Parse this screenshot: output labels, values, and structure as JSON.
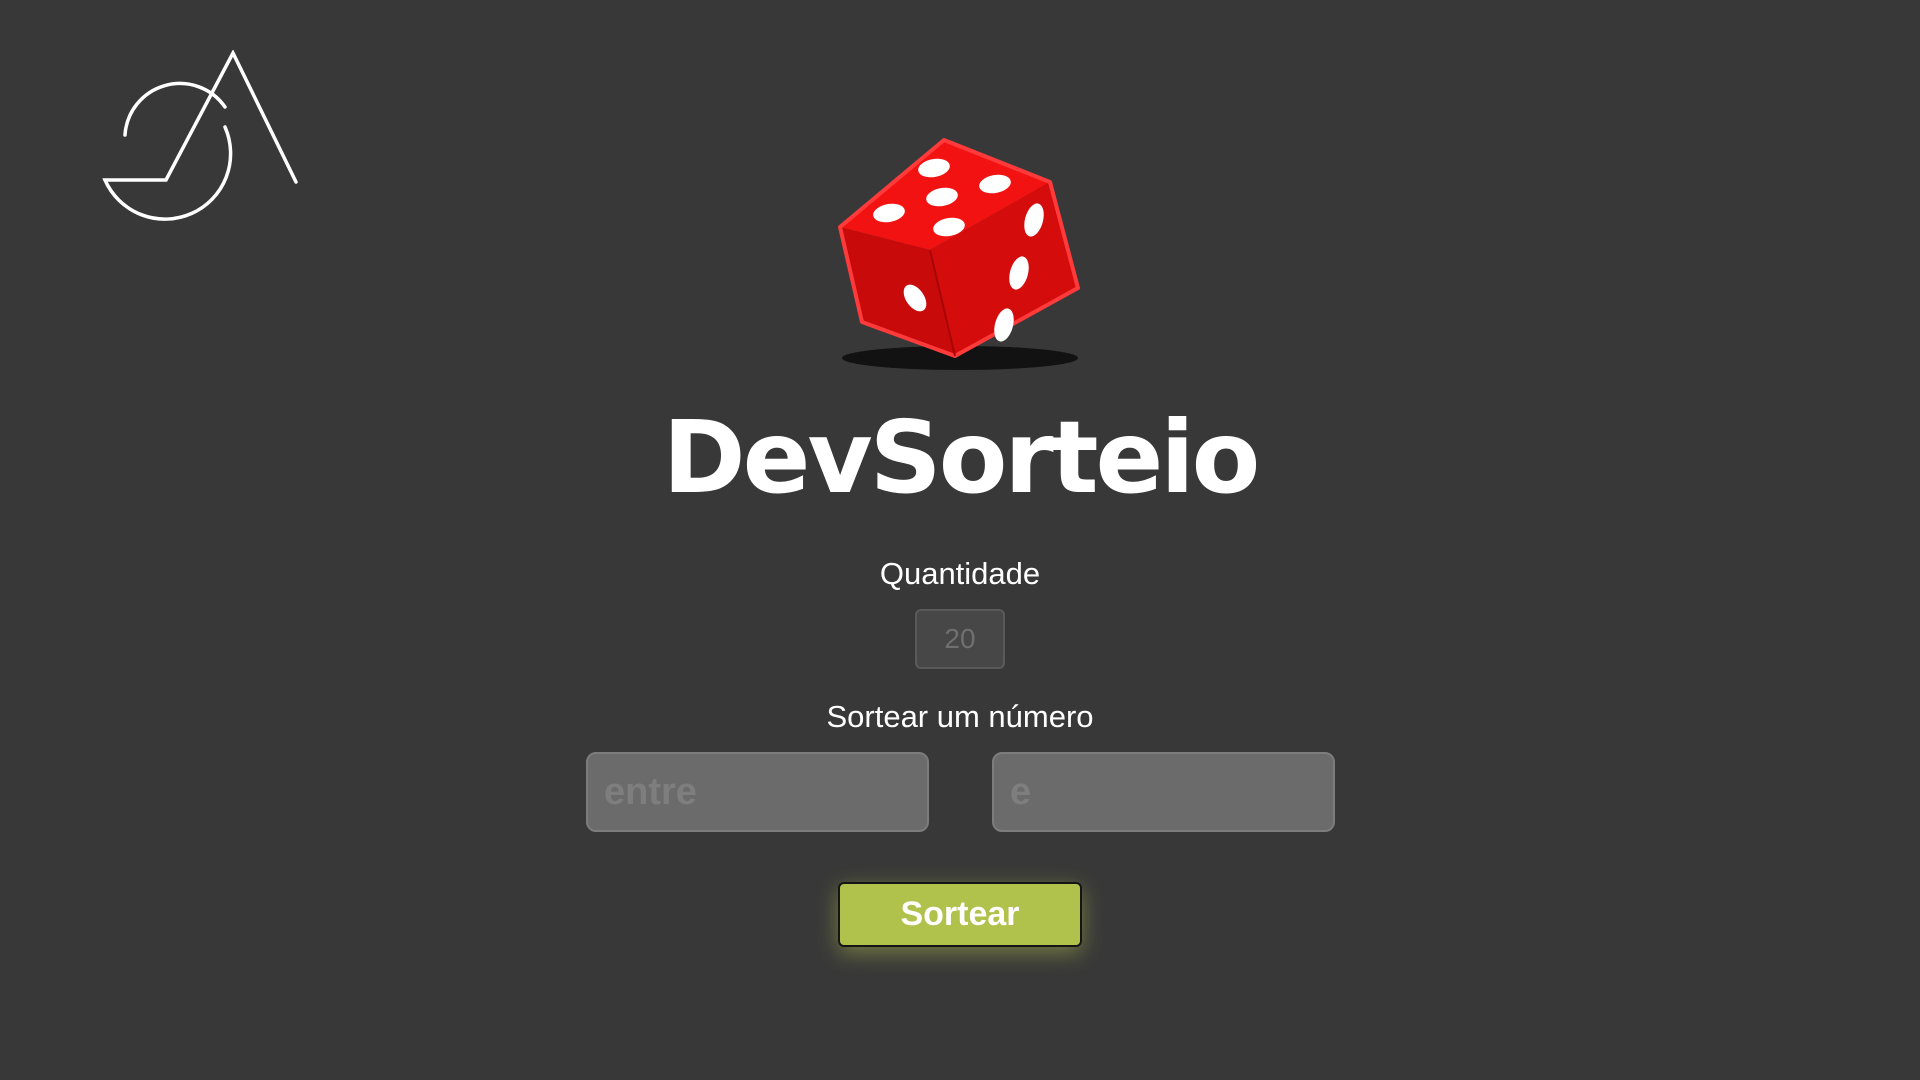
{
  "app": {
    "title": "DevSorteio"
  },
  "logo": {
    "icon": "ga-logo-icon"
  },
  "hero": {
    "icon": "dice-icon"
  },
  "form": {
    "quantity_label": "Quantidade",
    "quantity_placeholder": "20",
    "range_label": "Sortear um número",
    "from_placeholder": "entre",
    "to_placeholder": "e",
    "submit_label": "Sortear"
  },
  "colors": {
    "background": "#383838",
    "accent": "#b0c24c",
    "dice": "#e40d0d"
  }
}
